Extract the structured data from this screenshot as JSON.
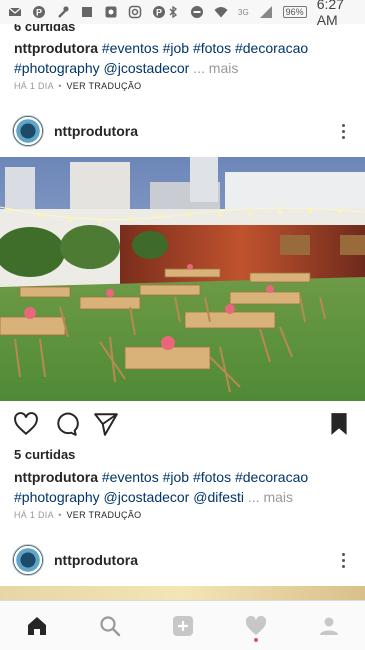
{
  "status_bar": {
    "time": "6:27 AM",
    "battery": "96%",
    "network": "3G",
    "icons": [
      "mail-icon",
      "pinterest-icon",
      "wrench-icon",
      "square-icon",
      "image-icon",
      "instagram-icon",
      "pinterest-icon",
      "bluetooth-icon",
      "minus-circle-icon",
      "wifi-icon",
      "signal-icon",
      "battery-icon"
    ]
  },
  "post_top": {
    "likes": "6 curtidas",
    "caption": {
      "user": "nttprodutora",
      "tags_line1": [
        "#eventos",
        "#job",
        "#fotos",
        "#decoracao"
      ],
      "tags_line2": [
        "#photography",
        "@jcostadecor"
      ],
      "more": "... mais"
    },
    "time_ago": "HÁ 1 DIA",
    "separator": "•",
    "translate": "VER TRADUÇÃO"
  },
  "post_main": {
    "username": "nttprodutora",
    "photo_icon": "outdoor-event-tables-photo",
    "likes": "5 curtidas",
    "caption": {
      "user": "nttprodutora",
      "tags_line1": [
        "#eventos",
        "#job",
        "#fotos",
        "#decoracao"
      ],
      "tags_line2": [
        "#photography",
        "@jcostadecor",
        "@difesti"
      ],
      "more": "... mais"
    },
    "time_ago": "HÁ 1 DIA",
    "separator": "•",
    "translate": "VER TRADUÇÃO"
  },
  "post_next": {
    "username": "nttprodutora"
  },
  "colors": {
    "tag": "#003569",
    "muted": "#999999",
    "notification_dot": "#ed4956"
  },
  "bottom_nav": [
    "home-icon",
    "search-icon",
    "add-post-icon",
    "activity-heart-icon",
    "profile-icon"
  ]
}
